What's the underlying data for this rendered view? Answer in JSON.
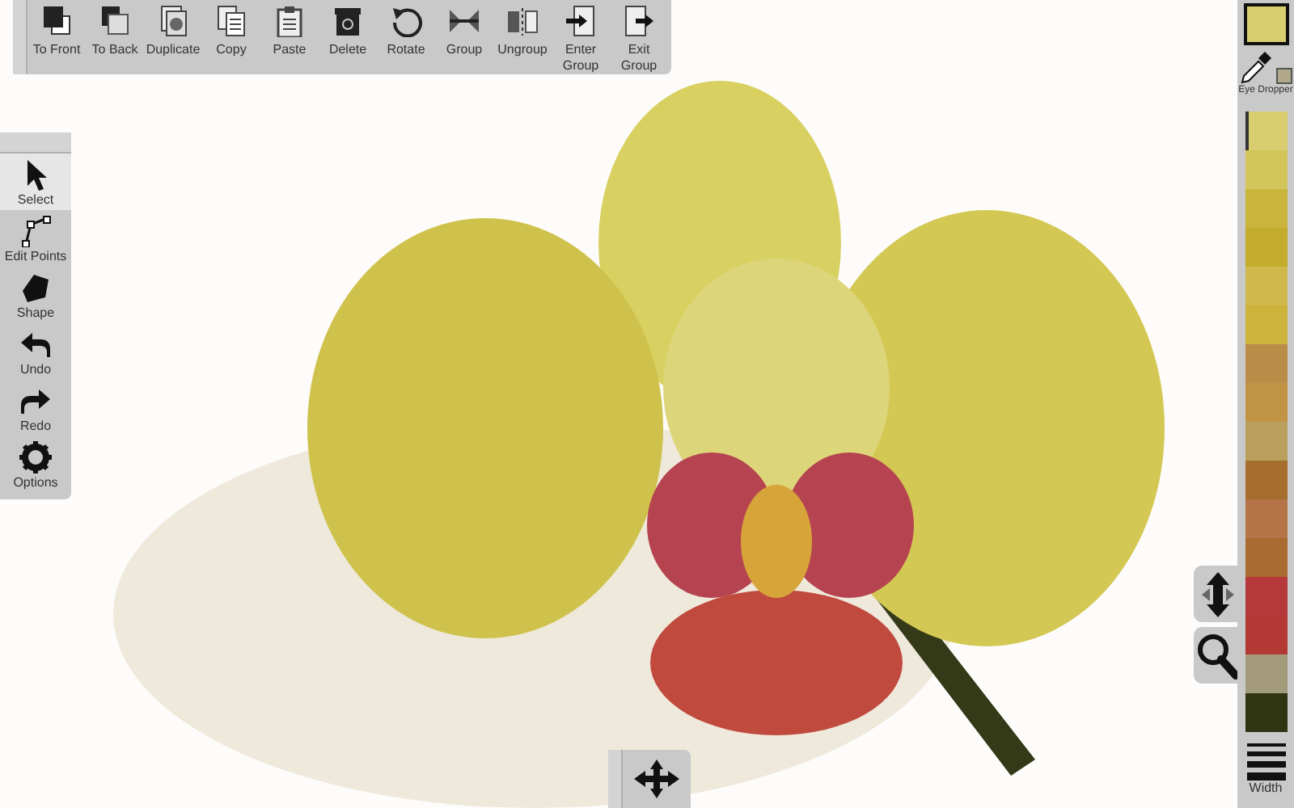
{
  "toolbar": {
    "buttons": [
      {
        "label": "To Front"
      },
      {
        "label": "To Back"
      },
      {
        "label": "Duplicate"
      },
      {
        "label": "Copy"
      },
      {
        "label": "Paste"
      },
      {
        "label": "Delete"
      },
      {
        "label": "Rotate"
      },
      {
        "label": "Group"
      },
      {
        "label": "Ungroup"
      },
      {
        "label": "Enter Group"
      },
      {
        "label": "Exit Group"
      }
    ]
  },
  "tools": [
    {
      "label": "Select",
      "selected": true
    },
    {
      "label": "Edit Points",
      "selected": false
    },
    {
      "label": "Shape",
      "selected": false
    },
    {
      "label": "Undo",
      "selected": false
    },
    {
      "label": "Redo",
      "selected": false
    },
    {
      "label": "Options",
      "selected": false
    }
  ],
  "color_panel": {
    "current": {
      "color": "#d8cd6f"
    },
    "eye_dropper": {
      "label": "Eye Dropper",
      "color": "#b0a888"
    },
    "swatches": [
      {
        "color": "#d8cd6f",
        "selected": true
      },
      {
        "color": "#d2c55a",
        "selected": false
      },
      {
        "color": "#c9b43c",
        "selected": false
      },
      {
        "color": "#c4ac2c",
        "selected": false
      },
      {
        "color": "#cfb94c",
        "selected": false
      },
      {
        "color": "#ccb33c",
        "selected": false
      },
      {
        "color": "#b98c48",
        "selected": false
      },
      {
        "color": "#c09444",
        "selected": false
      },
      {
        "color": "#b9a05c",
        "selected": false
      },
      {
        "color": "#a66e2e",
        "selected": false
      },
      {
        "color": "#b47448",
        "selected": false
      },
      {
        "color": "#a86c30",
        "selected": false
      },
      {
        "color": "#b5383a",
        "selected": false
      },
      {
        "color": "#b33a34",
        "selected": false
      },
      {
        "color": "#a39b7c",
        "selected": false
      },
      {
        "color": "#2f3412",
        "selected": false
      }
    ],
    "width_button": {
      "label": "Width"
    }
  }
}
